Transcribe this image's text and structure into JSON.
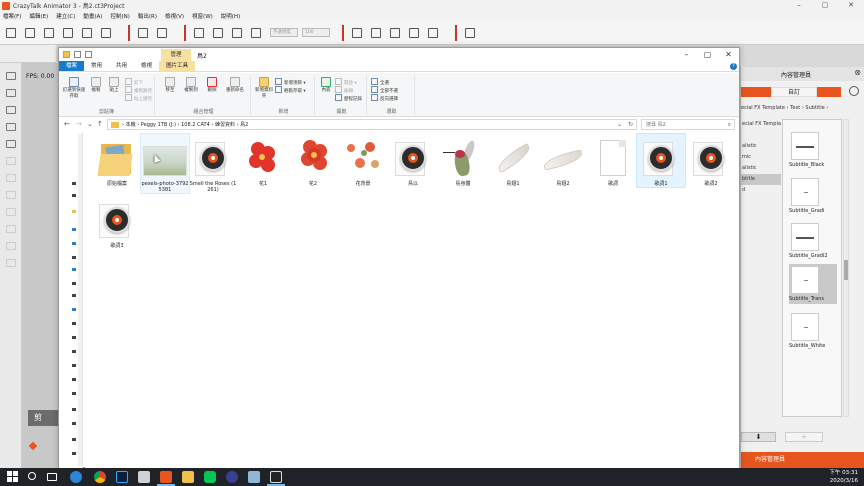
{
  "app": {
    "title": "CrazyTalk Animator 3 - 鳥2.ct3Project",
    "menu": [
      "檔案(F)",
      "編輯(E)",
      "建立(C)",
      "動畫(A)",
      "控制(N)",
      "輸出(R)",
      "檢視(V)",
      "視窗(W)",
      "說明(H)"
    ],
    "toolbar_field_placeholder": "不透明度",
    "toolbar_field_value": "100",
    "fps_text": "FPS: 0.00",
    "stage_label": "剪"
  },
  "content_manager": {
    "title": "內容管理員",
    "tab_left": "",
    "tab_selected": "自訂",
    "breadcrumb": "ecial FX Template › Text › Subtitle ›",
    "tree": [
      "ecial FX Template",
      "",
      "alistic",
      "mic",
      "alistic",
      "btitle",
      "d"
    ],
    "items": [
      {
        "name": "Subtitle_Black"
      },
      {
        "name": "Subtitle_Gradi"
      },
      {
        "name": "Subtitle_Gradi2"
      },
      {
        "name": "Subtitle_Trans"
      },
      {
        "name": "Subtitle_White"
      }
    ],
    "download_button": "⬇",
    "add_button": "+",
    "footer": "內容管理員"
  },
  "explorer": {
    "context_tab": "管理",
    "window_title": "鳥2",
    "tabs": [
      "檔案",
      "常用",
      "共用",
      "檢視",
      "圖片工具"
    ],
    "ribbon": {
      "clipboard": {
        "label": "剪貼簿",
        "pin": "釘選到快速存取",
        "copy": "複製",
        "paste": "貼上",
        "cut": "剪下",
        "copy_path": "複製路徑",
        "paste_shortcut": "貼上捷徑"
      },
      "organize": {
        "label": "組合管理",
        "move_to": "移至",
        "copy_to": "複製到",
        "delete": "刪除",
        "rename": "重新命名"
      },
      "new": {
        "label": "新增",
        "new_folder": "新增資料夾",
        "new_item": "新增項目 ▾",
        "easy_access": "輕鬆存取 ▾"
      },
      "open": {
        "label": "開啟",
        "properties": "內容",
        "open": "開啟 ▾",
        "edit": "編輯",
        "history": "歷程記錄"
      },
      "select": {
        "label": "選取",
        "select_all": "全選",
        "select_none": "全部不選",
        "invert": "反向選擇"
      }
    },
    "address": {
      "path": [
        "本機",
        "Peggy 1TB (J:)",
        "108.2 CAT4",
        "練習資料",
        "鳥2"
      ],
      "search_placeholder": "搜尋 鳥2"
    },
    "files": [
      {
        "name": "原始檔案",
        "kind": "folder"
      },
      {
        "name": "pexels-photo-37925381",
        "kind": "photo"
      },
      {
        "name": "Smell the Roses (1261)",
        "kind": "cd"
      },
      {
        "name": "花1",
        "kind": "flower1"
      },
      {
        "name": "花2",
        "kind": "flower2"
      },
      {
        "name": "花背景",
        "kind": "flowerbg"
      },
      {
        "name": "鳥以",
        "kind": "cd"
      },
      {
        "name": "鳥身體",
        "kind": "bird"
      },
      {
        "name": "鳥翅1",
        "kind": "wing1"
      },
      {
        "name": "鳥翅2",
        "kind": "wing2"
      },
      {
        "name": "歌詞",
        "kind": "doc"
      },
      {
        "name": "歌詞1",
        "kind": "cd"
      },
      {
        "name": "歌詞2",
        "kind": "cd"
      },
      {
        "name": "歌詞3",
        "kind": "cd"
      }
    ]
  },
  "taskbar": {
    "time": "下午 03:31",
    "date": "2020/3/16"
  },
  "colors": {
    "accent": "#e8541e",
    "explorer_blue": "#1979ca",
    "picture_tools": "#f8e1a0",
    "taskbar": "#1f2327"
  }
}
